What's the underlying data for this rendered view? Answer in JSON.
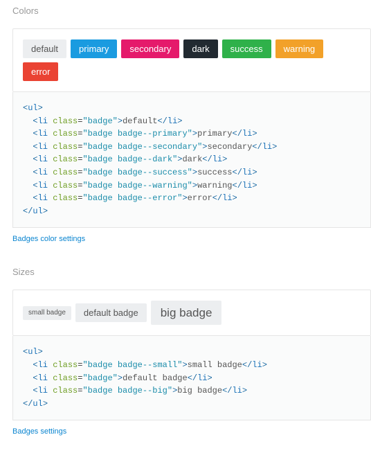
{
  "colors": {
    "heading": "Colors",
    "badges": [
      {
        "label": "default",
        "class": "badge"
      },
      {
        "label": "primary",
        "class": "badge badge--primary"
      },
      {
        "label": "secondary",
        "class": "badge badge--secondary"
      },
      {
        "label": "dark",
        "class": "badge badge--dark"
      },
      {
        "label": "success",
        "class": "badge badge--success"
      },
      {
        "label": "warning",
        "class": "badge badge--warning"
      },
      {
        "label": "error",
        "class": "badge badge--error"
      }
    ],
    "link": "Badges color settings"
  },
  "sizes": {
    "heading": "Sizes",
    "badges": [
      {
        "label": "small badge",
        "class": "badge badge--small"
      },
      {
        "label": "default badge",
        "class": "badge"
      },
      {
        "label": "big badge",
        "class": "badge badge--big"
      }
    ],
    "link": "Badges settings"
  }
}
